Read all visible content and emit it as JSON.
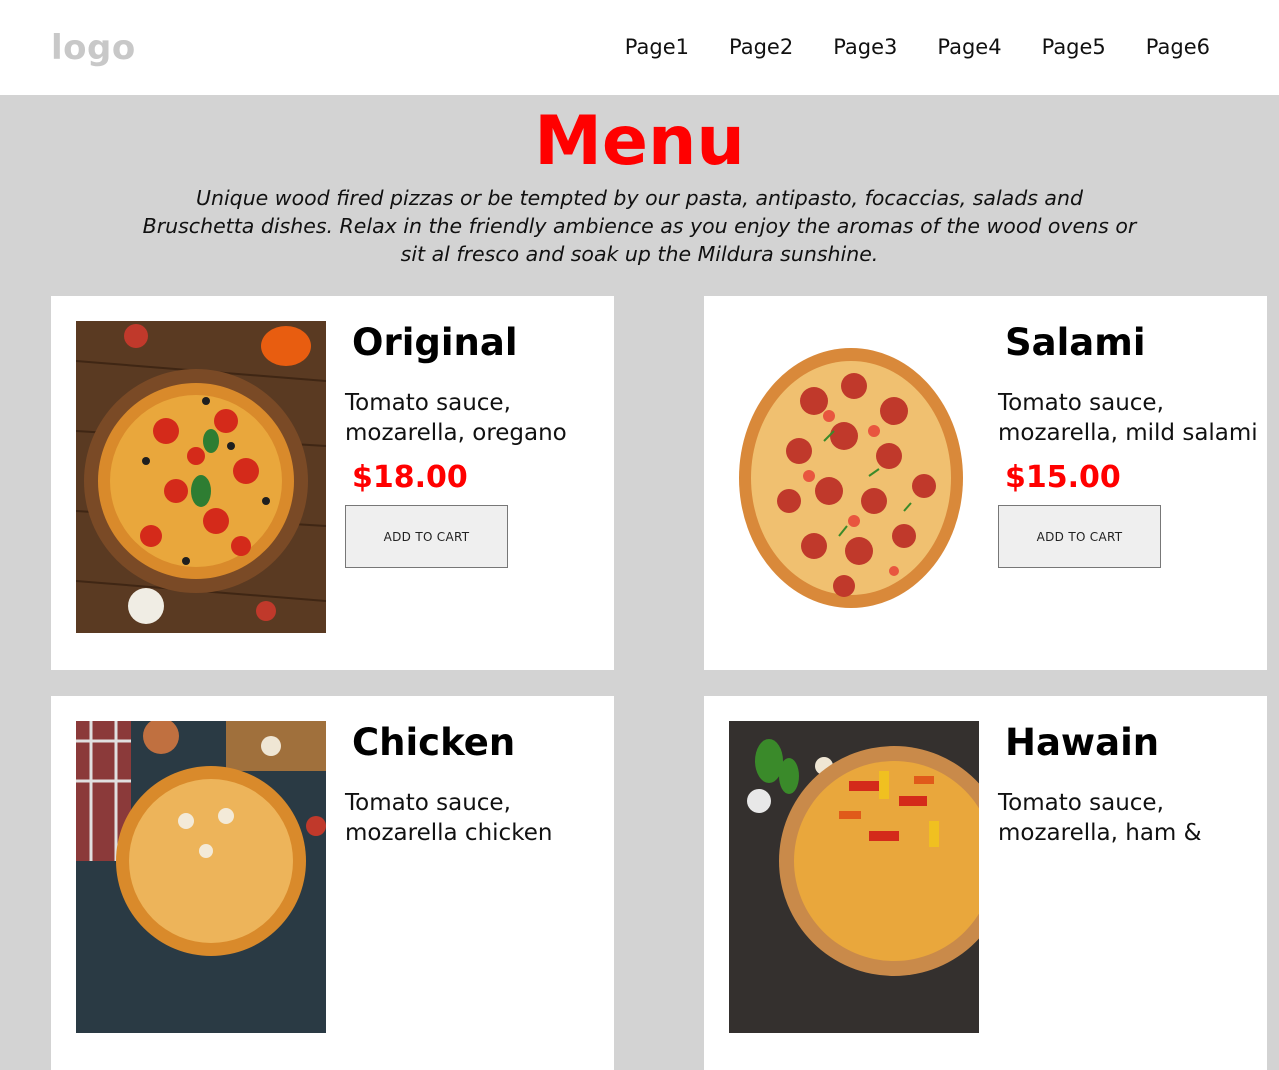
{
  "header": {
    "logo": "logo",
    "nav": [
      "Page1",
      "Page2",
      "Page3",
      "Page4",
      "Page5",
      "Page6"
    ]
  },
  "hero": {
    "title": "Menu",
    "intro": "Unique wood fired pizzas or be tempted by our pasta, antipasto, focaccias, salads and Bruschetta dishes. Relax in the friendly ambience as you enjoy the aromas of the wood ovens or sit al fresco and soak up the Mildura sunshine."
  },
  "items": [
    {
      "name": "Original",
      "description": "Tomato sauce, mozarella, oregano",
      "price": "$18.00",
      "button": "ADD TO CART"
    },
    {
      "name": "Salami",
      "description": "Tomato sauce, mozarella, mild salami",
      "price": "$15.00",
      "button": "ADD TO CART"
    },
    {
      "name": "Chicken",
      "description": "Tomato sauce, mozarella chicken",
      "price": "",
      "button": ""
    },
    {
      "name": "Hawain",
      "description": "Tomato sauce, mozarella, ham &",
      "price": "",
      "button": ""
    }
  ],
  "colors": {
    "accent": "#ff0000",
    "background": "#d3d3d3",
    "logo": "#c8c8c8"
  }
}
